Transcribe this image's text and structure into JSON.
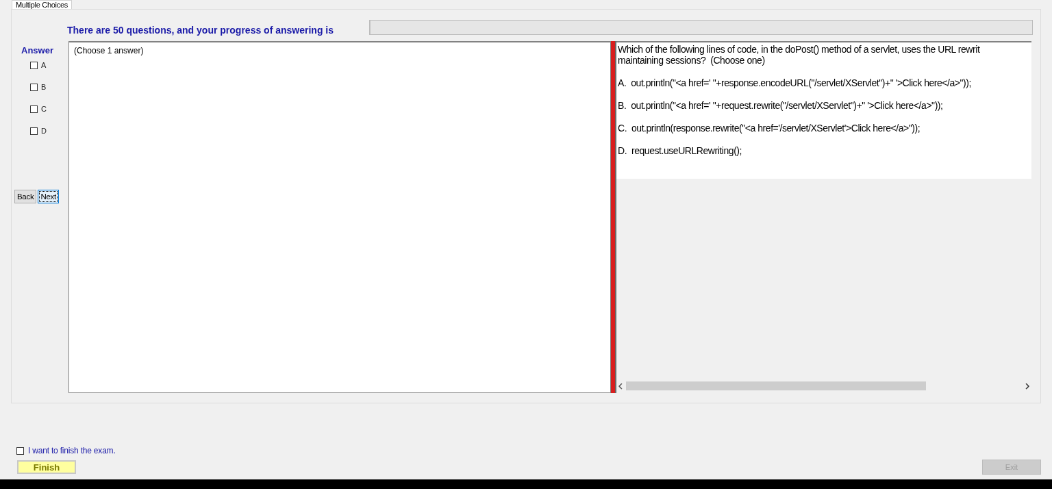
{
  "tabs": [
    {
      "label": "Multiple Choices",
      "selected": true
    }
  ],
  "header": {
    "text": "There are 50 questions, and your progress of answering is",
    "progress": {
      "level": 0
    }
  },
  "answer": {
    "title": "Answer",
    "options": [
      {
        "label": "A",
        "checked": false
      },
      {
        "label": "B",
        "checked": false
      },
      {
        "label": "C",
        "checked": false
      },
      {
        "label": "D",
        "checked": false
      }
    ]
  },
  "navigation": [
    {
      "label": "Back",
      "focused": false
    },
    {
      "label": "Next",
      "focused": true
    }
  ],
  "answer_note": "(Choose 1 answer)",
  "question": {
    "lines": [
      "Which of the following lines of code, in the doPost() method of a servlet, uses the URL rewrit",
      "maintaining sessions?  (Choose one)"
    ],
    "choices": [
      "A.  out.println(\"<a href=' \"+response.encodeURL(\"/servlet/XServlet\")+\" '>Click here</a>\"));",
      "B.  out.println(\"<a href=' \"+request.rewrite(\"/servlet/XServlet\")+\" '>Click here</a>\"));",
      "C.  out.println(response.rewrite(\"<a href='/servlet/XServlet'>Click here</a>\"));",
      "D.  request.useURLRewriting();"
    ]
  },
  "finish_confirm": {
    "label": "I want to finish the exam.",
    "checked": false
  },
  "finish_button": {
    "label": "Finish"
  },
  "exit_button": {
    "label": "Exit",
    "disabled": true
  }
}
